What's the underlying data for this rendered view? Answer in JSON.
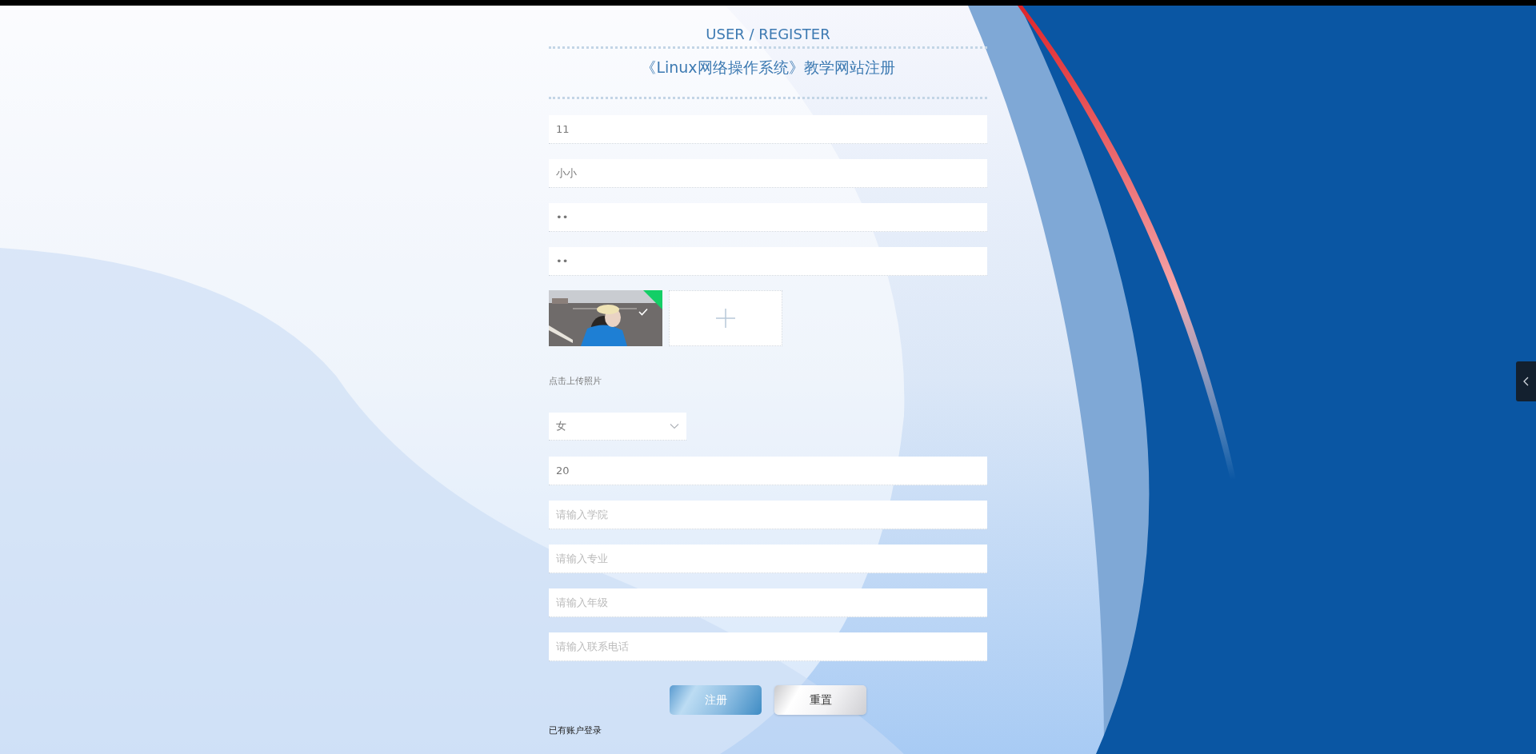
{
  "header": {
    "title": "USER / REGISTER",
    "subtitle": "《Linux网络操作系统》教学网站注册"
  },
  "fields_top": [
    {
      "value": "11"
    },
    {
      "value": "小小"
    },
    {
      "value": "••"
    },
    {
      "value": "••"
    }
  ],
  "upload": {
    "files": [
      {
        "kind": "picture",
        "uploaded": true
      }
    ],
    "hint": "点击上传照片"
  },
  "gender_select": {
    "value": "女"
  },
  "fields_bottom": [
    {
      "value": "20"
    },
    {
      "placeholder": "请输入学院"
    },
    {
      "placeholder": "请输入专业"
    },
    {
      "placeholder": "请输入年级"
    },
    {
      "placeholder": "请输入联系电话"
    }
  ],
  "buttons": [
    {
      "label": "注册",
      "kind": "primary"
    },
    {
      "label": "重置",
      "kind": "secondary"
    }
  ],
  "login_link": "已有账户登录"
}
